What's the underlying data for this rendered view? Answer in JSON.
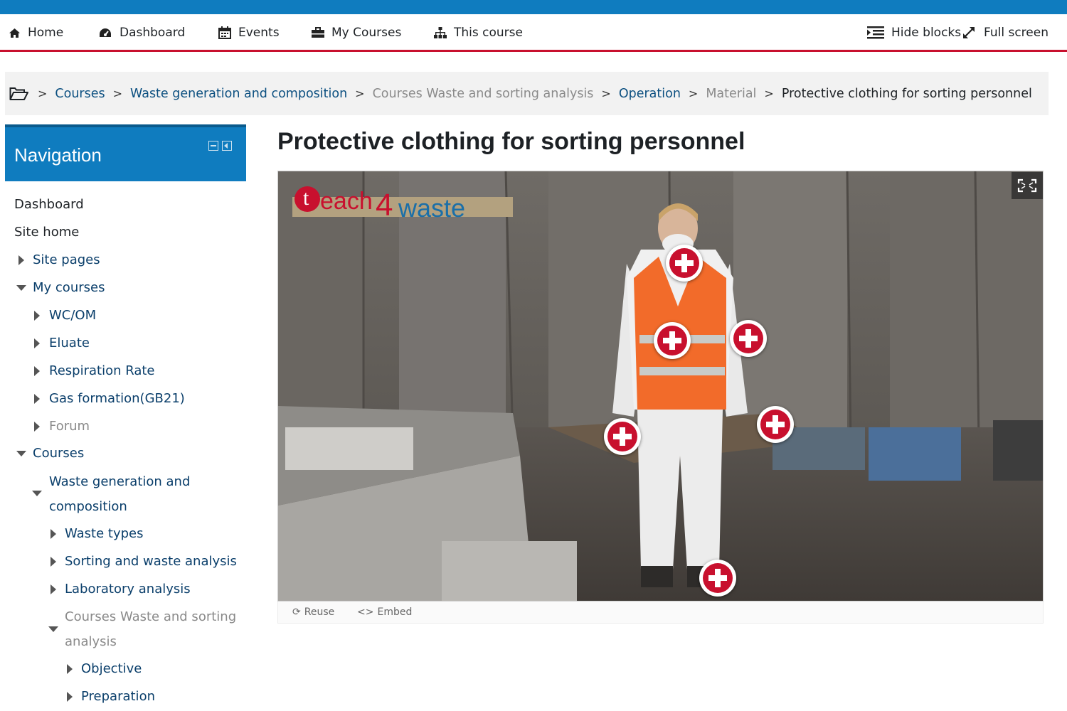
{
  "colors": {
    "accent_blue": "#0f7cbf",
    "brand_red": "#c8102e",
    "link": "#0b4f80"
  },
  "navbar": {
    "items": [
      {
        "label": "Home",
        "icon": "home-icon"
      },
      {
        "label": "Dashboard",
        "icon": "dashboard-icon"
      },
      {
        "label": "Events",
        "icon": "calendar-icon"
      },
      {
        "label": "My Courses",
        "icon": "briefcase-icon"
      },
      {
        "label": "This course",
        "icon": "sitemap-icon"
      }
    ],
    "hide_blocks": {
      "label": "Hide blocks",
      "icon": "indent-icon"
    },
    "full_screen": {
      "label": "Full screen",
      "icon": "expand-icon"
    }
  },
  "breadcrumb": {
    "home_icon": "folder-open-icon",
    "items": [
      {
        "label": "Courses",
        "style": "link"
      },
      {
        "label": "Waste generation and composition",
        "style": "link"
      },
      {
        "label": "Courses Waste and sorting analysis",
        "style": "muted"
      },
      {
        "label": "Operation",
        "style": "link"
      },
      {
        "label": "Material",
        "style": "muted"
      },
      {
        "label": "Protective clothing for sorting personnel",
        "style": "current"
      }
    ]
  },
  "navigation_block": {
    "title": "Navigation",
    "items": [
      {
        "label": "Dashboard",
        "toggle": "none",
        "style": "plain"
      },
      {
        "label": "Site home",
        "toggle": "none",
        "style": "plain"
      },
      {
        "label": "Site pages",
        "toggle": "collapsed",
        "style": "link"
      },
      {
        "label": "My courses",
        "toggle": "expanded",
        "style": "link"
      },
      {
        "label": "WC/OM",
        "toggle": "collapsed",
        "style": "link"
      },
      {
        "label": "Eluate",
        "toggle": "collapsed",
        "style": "link"
      },
      {
        "label": "Respiration Rate",
        "toggle": "collapsed",
        "style": "link"
      },
      {
        "label": "Gas formation(GB21)",
        "toggle": "collapsed",
        "style": "link"
      },
      {
        "label": "Forum",
        "toggle": "collapsed",
        "style": "muted"
      },
      {
        "label": "Courses",
        "toggle": "expanded",
        "style": "link"
      },
      {
        "label": "Waste generation and",
        "label2": "composition",
        "toggle": "expanded",
        "style": "link"
      },
      {
        "label": "Waste types",
        "toggle": "collapsed",
        "style": "link"
      },
      {
        "label": "Sorting and waste analysis",
        "toggle": "collapsed",
        "style": "link"
      },
      {
        "label": "Laboratory analysis",
        "toggle": "collapsed",
        "style": "link"
      },
      {
        "label": "Courses Waste and sorting",
        "label2": "analysis",
        "toggle": "expanded",
        "style": "muted"
      },
      {
        "label": "Objective",
        "toggle": "collapsed",
        "style": "link"
      },
      {
        "label": "Preparation",
        "toggle": "collapsed",
        "style": "link"
      }
    ]
  },
  "main": {
    "title": "Protective clothing for sorting personnel",
    "logo": {
      "part1": "each",
      "part2": "4",
      "part3": "waste",
      "t": "t"
    },
    "hotspot_count": 6,
    "fullscreen_icon": "fullscreen-icon",
    "actions": [
      {
        "label": "Reuse",
        "icon": "refresh-icon",
        "glyph": "⟳"
      },
      {
        "label": "Embed",
        "icon": "code-icon",
        "glyph": "<>"
      }
    ]
  }
}
